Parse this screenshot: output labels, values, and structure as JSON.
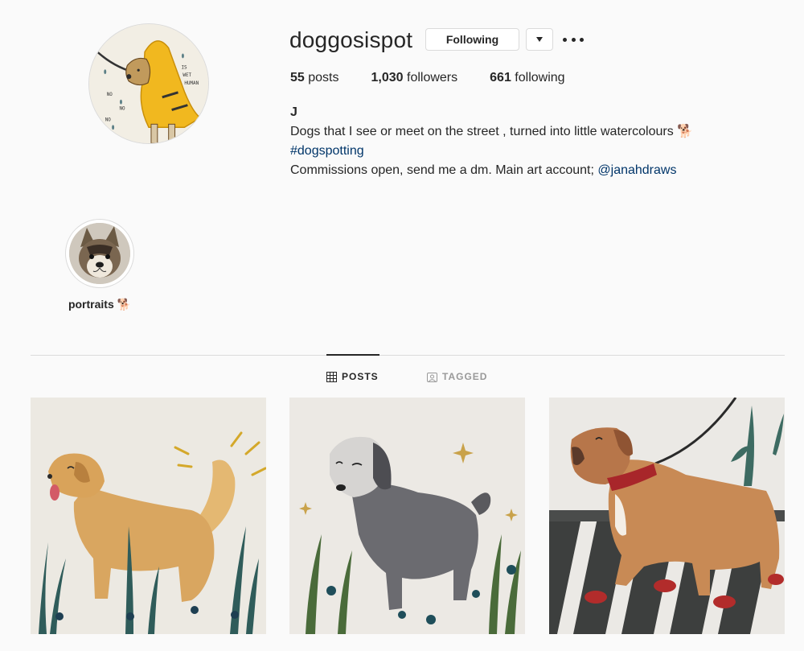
{
  "profile": {
    "username": "doggosispot",
    "follow_button": "Following",
    "stats": {
      "posts_count": "55",
      "posts_label": "posts",
      "followers_count": "1,030",
      "followers_label": "followers",
      "following_count": "661",
      "following_label": "following"
    },
    "bio": {
      "name": "J",
      "line1": "Dogs that I see or meet on the street , turned into little watercolours 🐕",
      "hashtag": "#dogspotting",
      "line3_text": "Commissions open, send me a dm. Main art account; ",
      "mention": "@janahdraws"
    },
    "avatar_art_text": [
      "IS",
      "WET",
      "HUMAN",
      "NO",
      "NO",
      "NO"
    ]
  },
  "highlights": [
    {
      "label": "portraits 🐕"
    }
  ],
  "tabs": [
    {
      "label": "POSTS",
      "icon": "grid-icon",
      "active": true
    },
    {
      "label": "TAGGED",
      "icon": "tagged-icon",
      "active": false
    }
  ],
  "posts": [
    {
      "subject": "golden retriever watercolour",
      "icon": "image-thumbnail"
    },
    {
      "subject": "grey shaggy dog watercolour",
      "icon": "image-thumbnail"
    },
    {
      "subject": "boxer dog with red shoes watercolour",
      "icon": "image-thumbnail"
    }
  ],
  "colors": {
    "background": "#fafafa",
    "text": "#262626",
    "link": "#003569",
    "border": "#dbdbdb",
    "inactive_tab": "#999999"
  }
}
